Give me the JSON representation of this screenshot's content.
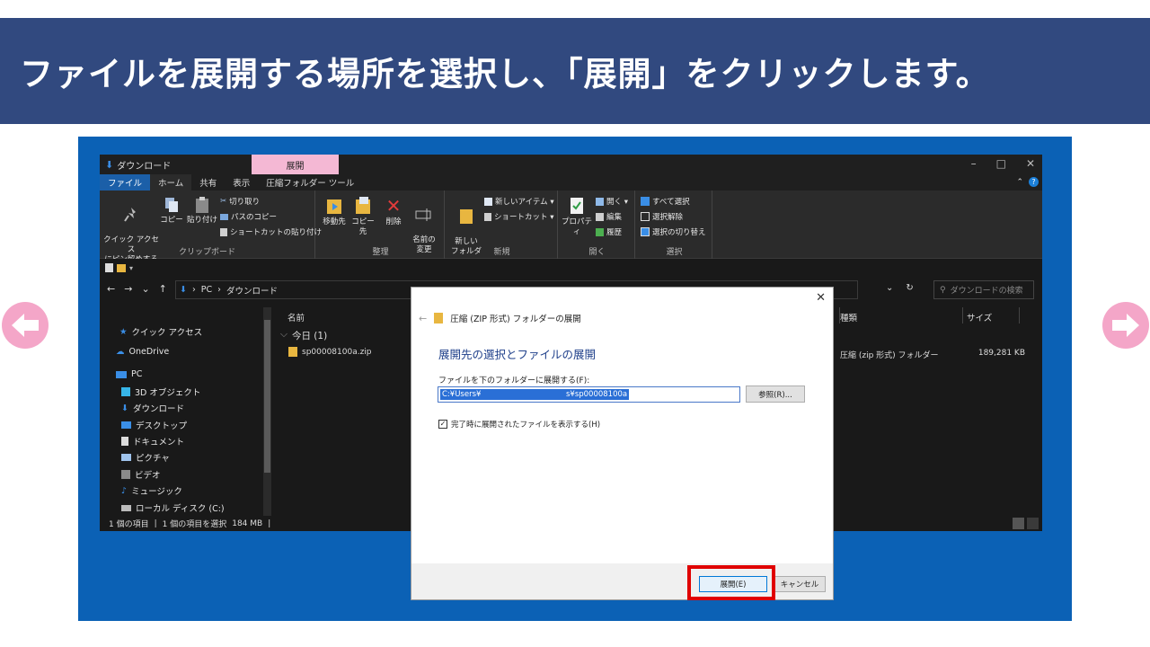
{
  "banner": {
    "text": "ファイルを展開する場所を選択し、「展開」をクリックします。"
  },
  "colors": {
    "banner_bg": "#31497f",
    "frame_bg": "#0b61b5",
    "arrow": "#f4a6c8",
    "highlight": "#e00000",
    "context_tab": "#f4b8d4"
  },
  "explorer": {
    "title": "ダウンロード",
    "context_tab": "展開",
    "window_controls": [
      "–",
      "□",
      "✕"
    ],
    "tabs": [
      "ファイル",
      "ホーム",
      "共有",
      "表示",
      "圧縮フォルダー ツール"
    ],
    "ribbon": {
      "clipboard": {
        "pin": "クイック アクセス\nにピン留めする",
        "copy": "コピー",
        "paste": "貼り付け",
        "cut": "切り取り",
        "copy_path": "パスのコピー",
        "paste_shortcut": "ショートカットの貼り付け",
        "label": "クリップボード"
      },
      "organize": {
        "move_to": "移動先",
        "copy_to": "コピー先",
        "delete": "削除",
        "rename": "名前の\n変更",
        "label": "整理"
      },
      "new": {
        "new_folder": "新しい\nフォルダー",
        "new_item": "新しいアイテム ▾",
        "shortcut": "ショートカット ▾",
        "label": "新規"
      },
      "open": {
        "properties": "プロパティ",
        "open": "開く ▾",
        "edit": "編集",
        "history": "履歴",
        "label": "開く"
      },
      "select": {
        "select_all": "すべて選択",
        "select_none": "選択解除",
        "invert": "選択の切り替え",
        "label": "選択"
      }
    },
    "address": {
      "nav": [
        "←",
        "→",
        "⌄",
        "↑"
      ],
      "path": [
        "PC",
        "ダウンロード"
      ],
      "search_placeholder": "ダウンロードの検索",
      "dropdown": "⌄",
      "refresh": "↻"
    },
    "nav_pane": [
      {
        "label": "クイック アクセス",
        "icon": "star-icon"
      },
      {
        "label": "OneDrive",
        "icon": "cloud-icon"
      },
      {
        "label": "PC",
        "icon": "pc-icon"
      },
      {
        "label": "3D オブジェクト",
        "icon": "cube-icon"
      },
      {
        "label": "ダウンロード",
        "icon": "download-icon"
      },
      {
        "label": "デスクトップ",
        "icon": "desktop-icon"
      },
      {
        "label": "ドキュメント",
        "icon": "document-icon"
      },
      {
        "label": "ピクチャ",
        "icon": "picture-icon"
      },
      {
        "label": "ビデオ",
        "icon": "video-icon"
      },
      {
        "label": "ミュージック",
        "icon": "music-icon"
      },
      {
        "label": "ローカル ディスク (C:)",
        "icon": "disk-icon"
      }
    ],
    "columns": {
      "name": "名前",
      "type": "種類",
      "size": "サイズ"
    },
    "group": "今日 (1)",
    "file": {
      "name": "sp00008100a.zip",
      "type": "圧縮 (zip 形式) フォルダー",
      "size": "189,281 KB"
    },
    "status": {
      "items": "1 個の項目",
      "selected": "1 個の項目を選択",
      "size": "184 MB"
    }
  },
  "dialog": {
    "header": "圧縮 (ZIP 形式) フォルダーの展開",
    "heading": "展開先の選択とファイルの展開",
    "field_label": "ファイルを下のフォルダーに展開する(F):",
    "path_value": "C:¥Users¥                                   s¥sp00008100a",
    "browse": "参照(R)...",
    "checkbox": "完了時に展開されたファイルを表示する(H)",
    "checked": true,
    "extract": "展開(E)",
    "cancel": "キャンセル",
    "close": "✕",
    "back": "←"
  }
}
